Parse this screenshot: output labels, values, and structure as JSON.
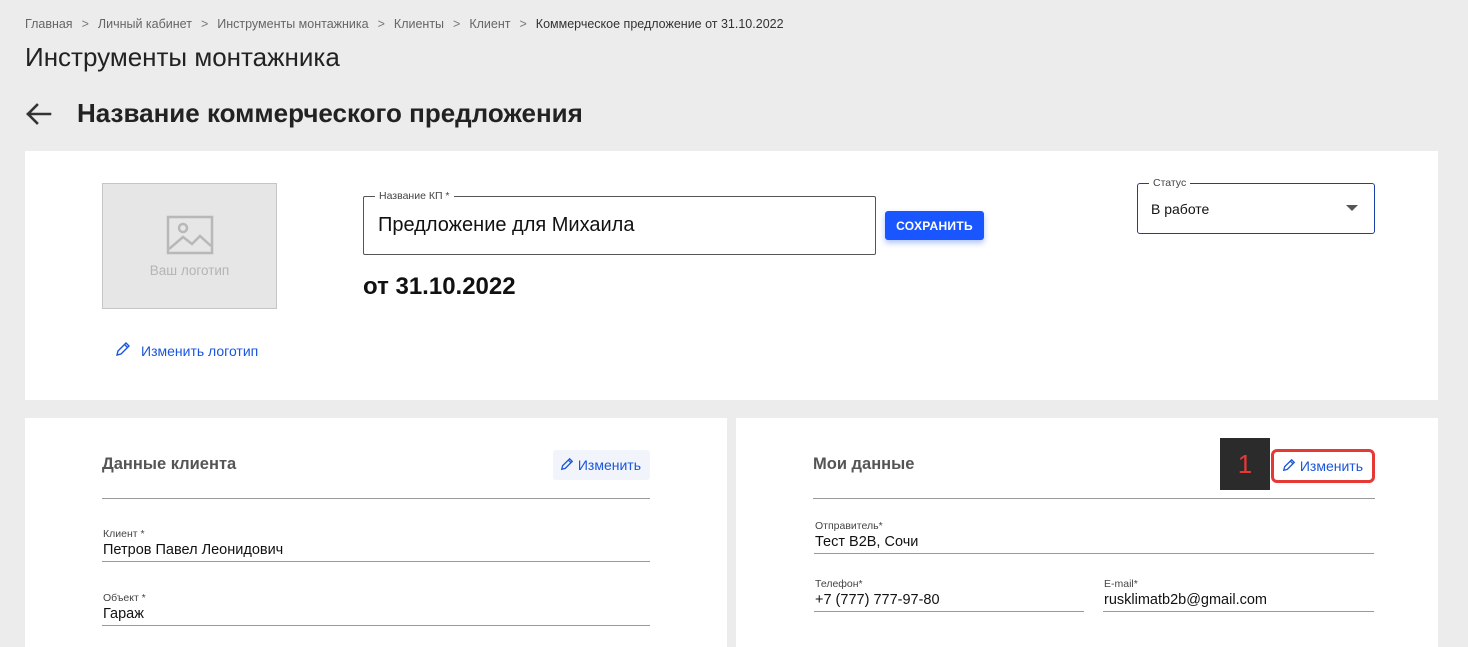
{
  "breadcrumb": {
    "items": [
      "Главная",
      "Личный кабинет",
      "Инструменты монтажника",
      "Клиенты",
      "Клиент"
    ],
    "current": "Коммерческое предложение от 31.10.2022",
    "separator": ">"
  },
  "page_title": "Инструменты монтажника",
  "section_title": "Название коммерческого предложения",
  "logo": {
    "placeholder_text": "Ваш логотип",
    "change_label": "Изменить логотип"
  },
  "kp_field": {
    "label": "Название КП *",
    "value": "Предложение для Михаила"
  },
  "save_label": "СОХРАНИТЬ",
  "date_text": "от 31.10.2022",
  "status_field": {
    "label": "Статус",
    "value": "В работе"
  },
  "client_panel": {
    "title": "Данные клиента",
    "edit_label": "Изменить",
    "fields": {
      "client": {
        "label": "Клиент *",
        "value": "Петров Павел Леонидович"
      },
      "object": {
        "label": "Объект *",
        "value": "Гараж"
      }
    }
  },
  "my_panel": {
    "title": "Мои данные",
    "edit_label": "Изменить",
    "step_number": "1",
    "fields": {
      "sender": {
        "label": "Отправитель*",
        "value": "Тест B2B, Сочи"
      },
      "phone": {
        "label": "Телефон*",
        "value": "+7 (777) 777-97-80"
      },
      "email": {
        "label": "E-mail*",
        "value": "rusklimatb2b@gmail.com"
      }
    }
  },
  "colors": {
    "accent": "#1a56ff",
    "highlight": "#e53935",
    "background": "#ececec"
  },
  "icons": {
    "back": "arrow-left-icon",
    "image": "image-placeholder-icon",
    "edit": "pencil-icon",
    "dropdown": "caret-down-icon"
  }
}
